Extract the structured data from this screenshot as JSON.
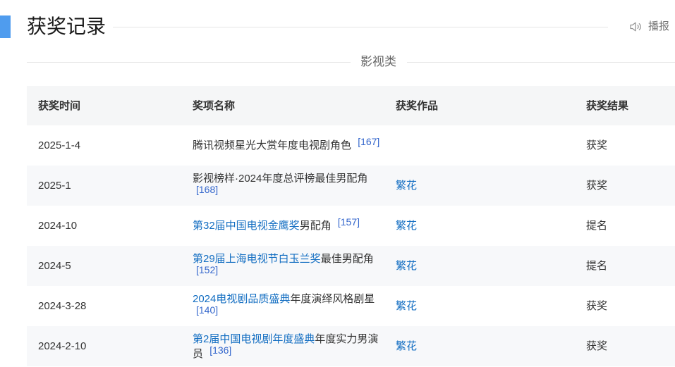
{
  "section": {
    "title": "获奖记录",
    "broadcast_label": "播报",
    "broadcast_icon": "speaker-icon"
  },
  "category": {
    "label": "影视类"
  },
  "table": {
    "headers": {
      "date": "获奖时间",
      "award": "奖项名称",
      "work": "获奖作品",
      "result": "获奖结果"
    },
    "rows": [
      {
        "date": "2025-1-4",
        "award": {
          "text": "腾讯视频星光大赏年度电视剧角色",
          "ref": "[167]"
        },
        "result": "获奖"
      },
      {
        "date": "2025-1",
        "award": {
          "text": "影视榜样·2024年度总评榜最佳男配角",
          "ref": "[168]"
        },
        "work": "繁花",
        "result": "获奖"
      },
      {
        "date": "2024-10",
        "award": {
          "link": "第32届中国电视金鹰奖",
          "text": "男配角",
          "ref": "[157]"
        },
        "work": "繁花",
        "result": "提名"
      },
      {
        "date": "2024-5",
        "award": {
          "link": "第29届上海电视节白玉兰奖",
          "text": "最佳男配角",
          "ref": "[152]"
        },
        "work": "繁花",
        "result": "提名"
      },
      {
        "date": "2024-3-28",
        "award": {
          "link": "2024电视剧品质盛典",
          "text": "年度演绎风格剧星",
          "ref": "[140]"
        },
        "work": "繁花",
        "result": "获奖"
      },
      {
        "date": "2024-2-10",
        "award": {
          "link": "第2届中国电视剧年度盛典",
          "text": "年度实力男演员",
          "ref": "[136]"
        },
        "work": "繁花",
        "result": "获奖"
      }
    ]
  },
  "colors": {
    "accent": "#4f9cee",
    "link": "#136ec2",
    "reference": "#3366cc",
    "text": "#333333",
    "muted": "#999999",
    "header_bg": "#f5f6f7",
    "stripe_bg": "#f7f8fa"
  }
}
